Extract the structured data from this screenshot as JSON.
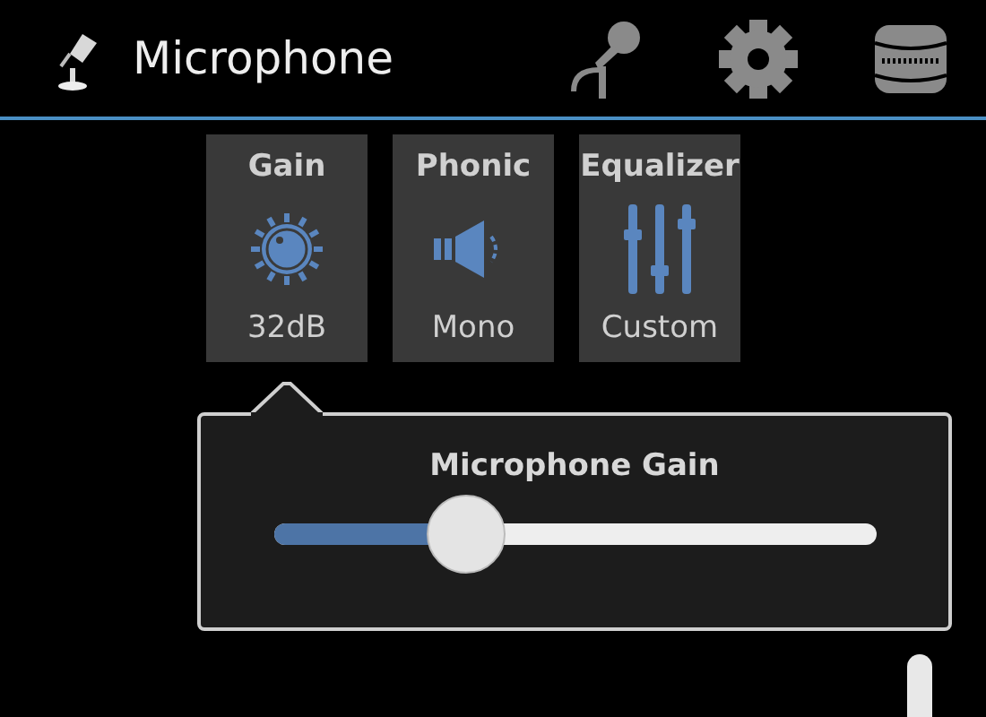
{
  "action_bar": {
    "title": "Microphone"
  },
  "tiles": [
    {
      "kind": "knob",
      "label": "Gain",
      "value": "32dB"
    },
    {
      "kind": "speaker",
      "label": "Phonic",
      "value": "Mono"
    },
    {
      "kind": "equalizer",
      "label": "Equalizer",
      "value": "Custom"
    }
  ],
  "popup": {
    "title": "Microphone Gain",
    "slider": {
      "level": 0.32
    }
  }
}
